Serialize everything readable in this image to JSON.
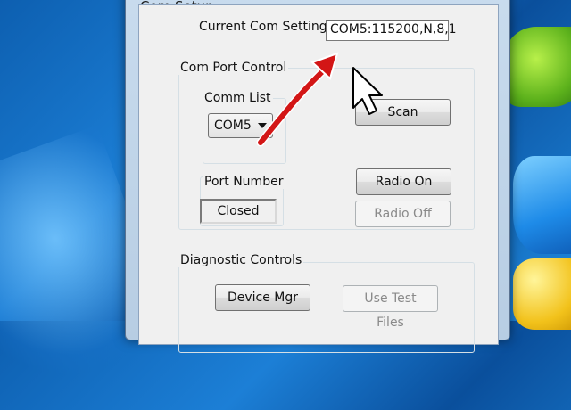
{
  "window": {
    "title": "Com Setup"
  },
  "current_settings": {
    "label": "Current Com Settings",
    "value": "COM5:115200,N,8,1"
  },
  "com_port_control": {
    "title": "Com Port Control",
    "comm_list_label": "Comm List",
    "comm_selected": "COM5",
    "port_number_label": "Port Number",
    "port_status": "Closed",
    "scan_label": "Scan",
    "radio_on_label": "Radio On",
    "radio_off_label": "Radio Off"
  },
  "diagnostic_controls": {
    "title": "Diagnostic Controls",
    "device_mgr_label": "Device Mgr",
    "use_test_files_label": "Use Test Files"
  },
  "colors": {
    "arrow_annotation": "#d31616",
    "desktop_blue": "#1c7fd6"
  },
  "icons": [
    "mouse-cursor-icon",
    "dropdown-arrow-icon",
    "annotation-arrow"
  ]
}
